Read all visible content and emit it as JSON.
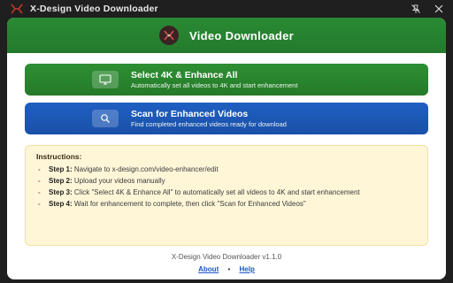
{
  "window": {
    "title": "X-Design Video Downloader",
    "app_icon": "x-design-logo-icon",
    "controls": [
      "pin-off-icon",
      "close-icon"
    ]
  },
  "header": {
    "title": "Video Downloader",
    "logo": "x-design-logo-icon"
  },
  "buttons": {
    "select_4k": {
      "label": "Select 4K & Enhance All",
      "description": "Automatically set all videos to 4K and start enhancement",
      "icon": "monitor-icon",
      "color": "#2a8a34"
    },
    "scan": {
      "label": "Scan for Enhanced Videos",
      "description": "Find completed enhanced videos ready for download",
      "icon": "search-icon",
      "color": "#1d58b8"
    }
  },
  "instructions": {
    "title": "Instructions:",
    "steps": [
      {
        "label": "Step 1:",
        "text": "Navigate to x-design.com/video-enhancer/edit"
      },
      {
        "label": "Step 2:",
        "text": "Upload your videos manually"
      },
      {
        "label": "Step 3:",
        "text": "Click \"Select 4K & Enhance All\" to automatically set all videos to 4K and start enhancement"
      },
      {
        "label": "Step 4:",
        "text": "Wait for enhancement to complete, then click \"Scan for Enhanced Videos\""
      }
    ]
  },
  "footer": {
    "version": "X-Design Video Downloader v1.1.0",
    "links": {
      "about": "About",
      "separator": "•",
      "help": "Help"
    }
  }
}
